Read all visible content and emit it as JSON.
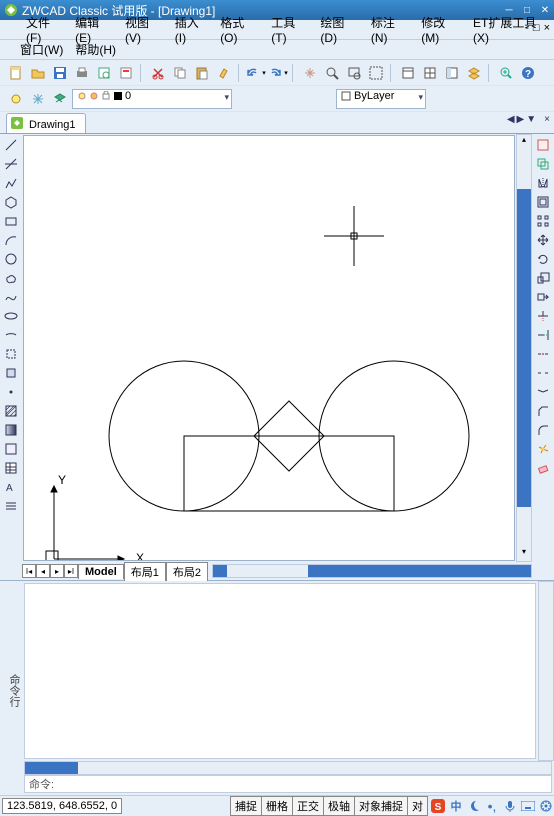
{
  "title": "ZWCAD Classic 试用版 - [Drawing1]",
  "menu": [
    "文件(F)",
    "编辑(E)",
    "视图(V)",
    "插入(I)",
    "格式(O)",
    "工具(T)",
    "绘图(D)",
    "标注(N)",
    "修改(M)",
    "ET扩展工具(X)"
  ],
  "menu2": [
    "窗口(W)",
    "帮助(H)"
  ],
  "toolbar1_icons": [
    "new-icon",
    "open-icon",
    "save-icon",
    "print-icon",
    "print-preview-icon",
    "plot-icon",
    "cut-icon",
    "copy-icon",
    "paste-icon",
    "format-painter-icon",
    "undo-icon",
    "redo-icon",
    "pan-icon",
    "zoom-icon",
    "zoom-window-icon",
    "zoom-extents-icon",
    "properties-icon",
    "table-icon",
    "layout-icon",
    "layer-icon",
    "zoom-in-icon",
    "help-icon"
  ],
  "layer_combo_value": "0",
  "layer_controls": [
    "layer-off-icon",
    "layer-freeze-icon",
    "layer-lock-icon",
    "layer-color-icon"
  ],
  "bylayer_label": "ByLayer",
  "doc_tab": "Drawing1",
  "doc_nav": [
    "◀",
    "▶",
    "▼",
    "×"
  ],
  "sub_nav": [
    "-",
    "□",
    "×"
  ],
  "left_tools": [
    "line-icon",
    "xline-icon",
    "polyline-icon",
    "polygon-icon",
    "rect-icon",
    "arc-icon",
    "circle-icon",
    "revcloud-icon",
    "spline-icon",
    "ellipse-icon",
    "ellipse-arc-icon",
    "block-icon",
    "make-block-icon",
    "point-icon",
    "hatch-icon",
    "gradient-icon",
    "region-icon",
    "table-icon",
    "mtext-icon",
    "addline-icon"
  ],
  "right_tools": [
    "entprop-icon",
    "copy-icon",
    "mirror-icon",
    "offset-icon",
    "array-icon",
    "move-icon",
    "rotate-icon",
    "scale-icon",
    "stretch-icon",
    "trim-icon",
    "extend-icon",
    "breakpoint-icon",
    "break-icon",
    "join-icon",
    "chamfer-icon",
    "fillet-icon",
    "explode-icon",
    "erase-icon"
  ],
  "ucs": {
    "x_label": "X",
    "y_label": "Y"
  },
  "model_tabs": [
    "Model",
    "布局1",
    "布局2"
  ],
  "cmd_side_label": "命令行",
  "cmd_prompt": "命令:",
  "status": {
    "coord": "123.5819, 648.6552, 0",
    "buttons": [
      "捕捉",
      "栅格",
      "正交",
      "极轴",
      "对象捕捉",
      "对"
    ]
  },
  "tray": [
    "ime-s-icon",
    "ime-zh-icon",
    "moon-icon",
    "dot-icon",
    "mic-icon",
    "keyboard-icon",
    "settings-icon"
  ],
  "colors": {
    "accent": "#3b74c3",
    "border": "#9cb1cc"
  }
}
